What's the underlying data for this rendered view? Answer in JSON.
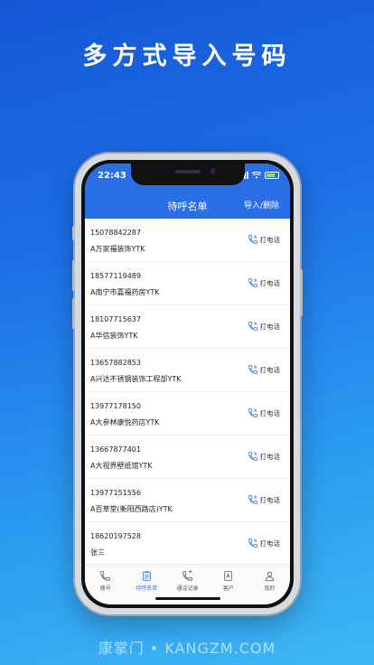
{
  "headline": "多方式导入号码",
  "status": {
    "time": "22:43"
  },
  "nav": {
    "title": "待呼名单",
    "action": "导入/删除"
  },
  "call_label": "打电话",
  "contacts": [
    {
      "phone": "15078842287",
      "name": "A万家福装饰YTK"
    },
    {
      "phone": "18577119489",
      "name": "A南宁市嘉福药房YTK"
    },
    {
      "phone": "18107715637",
      "name": "A华信装饰YTK"
    },
    {
      "phone": "13657882853",
      "name": "A兴达不锈钢装饰工程部YTK"
    },
    {
      "phone": "13977178150",
      "name": "A大参林康悦药店YTK"
    },
    {
      "phone": "13667877401",
      "name": "A大视界壁纸馆YTK"
    },
    {
      "phone": "13977151556",
      "name": "A百草堂(衡阳西路店)YTK"
    },
    {
      "phone": "18620197528",
      "name": "张三"
    }
  ],
  "tabs": [
    {
      "label": "拨号",
      "icon": "phone-icon",
      "active": false
    },
    {
      "label": "待呼名单",
      "icon": "clipboard-icon",
      "active": true
    },
    {
      "label": "通话记录",
      "icon": "call-log-icon",
      "active": false
    },
    {
      "label": "客户",
      "icon": "contact-card-icon",
      "active": false
    },
    {
      "label": "我的",
      "icon": "user-icon",
      "active": false
    }
  ],
  "footer": "康掌门 • KANGZM.COM",
  "colors": {
    "primary": "#2a6ee8",
    "background_top": "#1656d6",
    "background_bottom": "#3fb7f5"
  }
}
